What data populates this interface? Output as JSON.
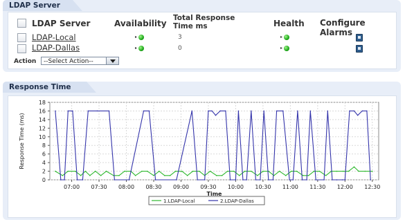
{
  "ldap_panel": {
    "title": "LDAP Server",
    "columns": {
      "server": "LDAP Server",
      "availability": "Availability",
      "response_line1": "Total Response",
      "response_line2": "Time  ms",
      "health": "Health",
      "alarms": "Configure Alarms"
    },
    "rows": [
      {
        "name": "LDAP-Local",
        "response_ms": "3",
        "availability": "up-arrow-green",
        "health": "green"
      },
      {
        "name": "LDAP-Dallas",
        "response_ms": "0",
        "availability": "up-arrow-green",
        "health": "green"
      }
    ],
    "action_label": "Action",
    "action_selected": "--Select Action--"
  },
  "response_panel": {
    "title": "Response Time"
  },
  "chart_data": {
    "type": "line",
    "title": "",
    "xlabel": "Time",
    "ylabel": "Response Time (ms)",
    "ylim": [
      0,
      18
    ],
    "yticks": [
      "0",
      "2",
      "4",
      "6",
      "8",
      "10",
      "12",
      "14",
      "16",
      "18"
    ],
    "xticks": [
      "07:00",
      "07:30",
      "08:00",
      "08:30",
      "09:00",
      "09:30",
      "10:00",
      "10:30",
      "11:00",
      "11:30",
      "12:00",
      "12:30"
    ],
    "xlim_minutes": [
      396,
      757
    ],
    "grid": true,
    "legend_position": "bottom",
    "series": [
      {
        "name": "1.LDAP-Local",
        "color": "#2eb82e",
        "points": [
          [
            402,
            2
          ],
          [
            410,
            1
          ],
          [
            416,
            2
          ],
          [
            424,
            2
          ],
          [
            430,
            1
          ],
          [
            435,
            2
          ],
          [
            440,
            1
          ],
          [
            446,
            2
          ],
          [
            452,
            1
          ],
          [
            458,
            2
          ],
          [
            466,
            1
          ],
          [
            472,
            1
          ],
          [
            478,
            2
          ],
          [
            485,
            2
          ],
          [
            490,
            1
          ],
          [
            497,
            2
          ],
          [
            503,
            2
          ],
          [
            510,
            1
          ],
          [
            516,
            2
          ],
          [
            522,
            1
          ],
          [
            528,
            1
          ],
          [
            534,
            2
          ],
          [
            541,
            2
          ],
          [
            547,
            1
          ],
          [
            553,
            2
          ],
          [
            560,
            2
          ],
          [
            566,
            1
          ],
          [
            572,
            2
          ],
          [
            579,
            1
          ],
          [
            585,
            1
          ],
          [
            591,
            2
          ],
          [
            598,
            2
          ],
          [
            604,
            1
          ],
          [
            610,
            2
          ],
          [
            617,
            2
          ],
          [
            624,
            1
          ],
          [
            630,
            2
          ],
          [
            636,
            2
          ],
          [
            642,
            1
          ],
          [
            648,
            2
          ],
          [
            655,
            1
          ],
          [
            661,
            2
          ],
          [
            667,
            2
          ],
          [
            674,
            1
          ],
          [
            680,
            1
          ],
          [
            686,
            2
          ],
          [
            692,
            2
          ],
          [
            699,
            1
          ],
          [
            705,
            2
          ],
          [
            711,
            2
          ],
          [
            718,
            2
          ],
          [
            724,
            2
          ],
          [
            730,
            3
          ],
          [
            735,
            2
          ],
          [
            742,
            2
          ],
          [
            750,
            2
          ]
        ]
      },
      {
        "name": "2.LDAP-Dallas",
        "color": "#3333aa",
        "points": [
          [
            402,
            16
          ],
          [
            408,
            0
          ],
          [
            412,
            0
          ],
          [
            416,
            16
          ],
          [
            421,
            16
          ],
          [
            426,
            0
          ],
          [
            432,
            0
          ],
          [
            438,
            16
          ],
          [
            448,
            16
          ],
          [
            461,
            16
          ],
          [
            467,
            0
          ],
          [
            483,
            0
          ],
          [
            499,
            16
          ],
          [
            505,
            16
          ],
          [
            512,
            0
          ],
          [
            535,
            0
          ],
          [
            552,
            16
          ],
          [
            558,
            0
          ],
          [
            566,
            0
          ],
          [
            570,
            16
          ],
          [
            574,
            16
          ],
          [
            578,
            15
          ],
          [
            583,
            16
          ],
          [
            589,
            16
          ],
          [
            594,
            0
          ],
          [
            600,
            0
          ],
          [
            603,
            16
          ],
          [
            608,
            0
          ],
          [
            612,
            0
          ],
          [
            617,
            16
          ],
          [
            622,
            0
          ],
          [
            627,
            0
          ],
          [
            631,
            16
          ],
          [
            636,
            0
          ],
          [
            641,
            0
          ],
          [
            645,
            16
          ],
          [
            652,
            16
          ],
          [
            659,
            0
          ],
          [
            663,
            0
          ],
          [
            668,
            16
          ],
          [
            673,
            0
          ],
          [
            678,
            0
          ],
          [
            682,
            16
          ],
          [
            688,
            0
          ],
          [
            697,
            0
          ],
          [
            701,
            16
          ],
          [
            706,
            0
          ],
          [
            711,
            0
          ],
          [
            717,
            0
          ],
          [
            720,
            0
          ],
          [
            725,
            16
          ],
          [
            730,
            16
          ],
          [
            734,
            15
          ],
          [
            739,
            16
          ],
          [
            744,
            16
          ],
          [
            748,
            0
          ]
        ]
      }
    ]
  }
}
